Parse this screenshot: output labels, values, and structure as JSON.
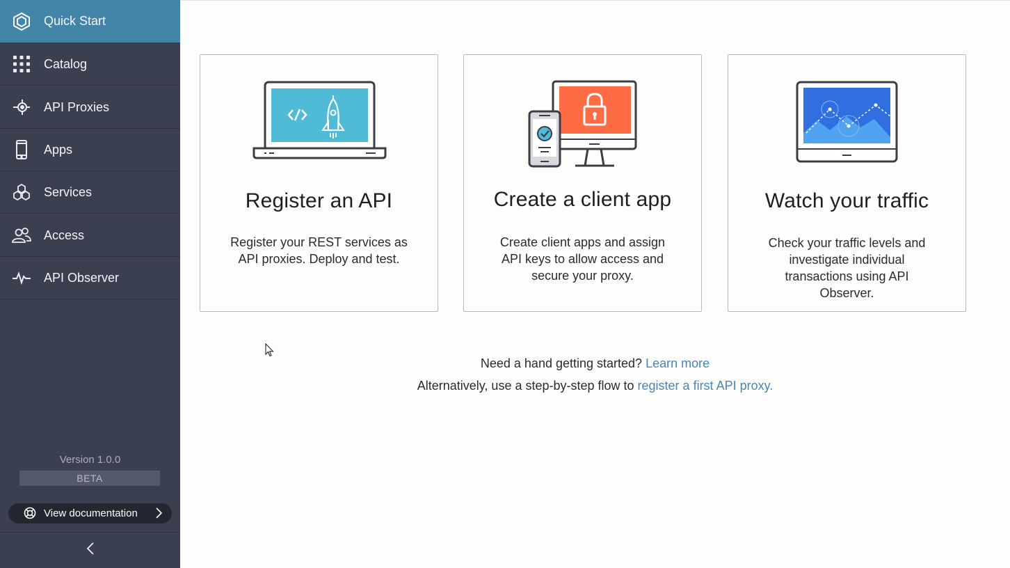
{
  "sidebar": {
    "items": [
      {
        "label": "Quick Start",
        "icon": "hexagon-icon",
        "active": true
      },
      {
        "label": "Catalog",
        "icon": "grid-icon"
      },
      {
        "label": "API Proxies",
        "icon": "proxy-icon"
      },
      {
        "label": "Apps",
        "icon": "phone-icon"
      },
      {
        "label": "Services",
        "icon": "services-icon"
      },
      {
        "label": "Access",
        "icon": "users-icon"
      },
      {
        "label": "API Observer",
        "icon": "pulse-icon"
      }
    ],
    "version": "Version 1.0.0",
    "beta": "BETA",
    "doc_button": "View documentation"
  },
  "cards": [
    {
      "title": "Register an API",
      "description": "Register your REST services as API proxies. Deploy and test."
    },
    {
      "title": "Create a client app",
      "description": "Create client apps and assign API keys to allow access and secure your proxy."
    },
    {
      "title": "Watch your traffic",
      "description": "Check your traffic levels and investigate individual transactions using API Observer."
    }
  ],
  "help": {
    "line1_text": "Need a hand getting started? ",
    "line1_link": "Learn more",
    "line2_text": "Alternatively, use a step-by-step flow to ",
    "line2_link": "register a first API proxy."
  },
  "colors": {
    "sidebar_bg": "#3b4050",
    "active_bg": "#4285a8",
    "link": "#4a86ad",
    "screen_cyan": "#4fbbd6",
    "screen_orange": "#ff6b45",
    "screen_blue": "#2f6fe0"
  }
}
